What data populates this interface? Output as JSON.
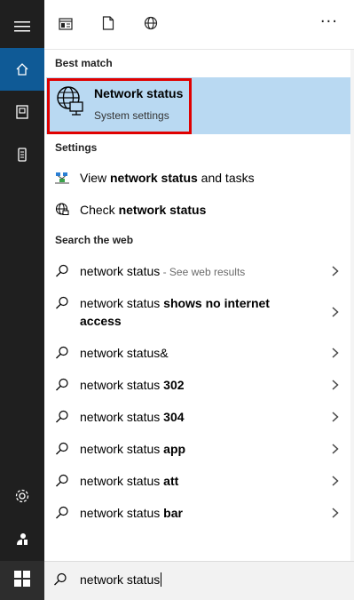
{
  "rail": {
    "items": [
      {
        "name": "menu-icon"
      },
      {
        "name": "home-icon",
        "active": true
      },
      {
        "name": "documents-icon"
      },
      {
        "name": "phone-icon"
      },
      {
        "name": "settings-icon"
      },
      {
        "name": "user-icon"
      },
      {
        "name": "windows-logo-icon"
      }
    ]
  },
  "toolbar": {
    "icons": [
      "apps-icon",
      "document-icon",
      "web-icon"
    ],
    "more_label": "···"
  },
  "best_match": {
    "heading": "Best match",
    "title": "Network status",
    "subtitle": "System settings",
    "icon": "globe-monitor-icon"
  },
  "settings": {
    "heading": "Settings",
    "items": [
      {
        "prefix": "View ",
        "bold": "network status",
        "suffix": " and tasks",
        "icon": "network-tasks-icon"
      },
      {
        "prefix": "Check ",
        "bold": "network status",
        "suffix": "",
        "icon": "globe-icon"
      }
    ]
  },
  "web": {
    "heading": "Search the web",
    "items": [
      {
        "text": "network status",
        "bold": "",
        "hint": " - See web results"
      },
      {
        "text": "network status ",
        "bold": "shows no internet access",
        "hint": ""
      },
      {
        "text": "network status&",
        "bold": "",
        "hint": ""
      },
      {
        "text": "network status ",
        "bold": "302",
        "hint": ""
      },
      {
        "text": "network status ",
        "bold": "304",
        "hint": ""
      },
      {
        "text": "network status ",
        "bold": "app",
        "hint": ""
      },
      {
        "text": "network status ",
        "bold": "att",
        "hint": ""
      },
      {
        "text": "network status ",
        "bold": "bar",
        "hint": ""
      }
    ]
  },
  "search": {
    "value": "network status",
    "icon": "search-icon"
  },
  "colors": {
    "rail_bg": "#1f1f1f",
    "active_accent": "#0f5a96",
    "selection": "#b9d9f2",
    "highlight_frame": "#e00000"
  }
}
